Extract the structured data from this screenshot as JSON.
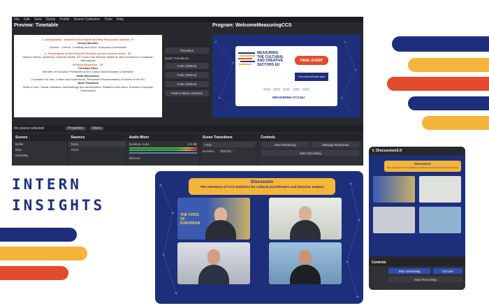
{
  "colors": {
    "navy": "#1d2f7a",
    "orange": "#f5b43a",
    "red": "#e24b2c",
    "obs_bg": "#27292f"
  },
  "heading": {
    "line1": "INTERN",
    "line2": "INSIGHTS"
  },
  "obs": {
    "menu": [
      "File",
      "Edit",
      "View",
      "Docks",
      "Profile",
      "Scene Collection",
      "Tools",
      "Help"
    ],
    "preview_title": "Preview: Timetable",
    "program_title": "Program: WelcomeMeasuringCCS",
    "timetable": {
      "item1": "1. Introduction - context of the report and why this project started - 5'",
      "speaker1": "Georg Haeusler",
      "role1": "Director - Culture, Creativity and Sport, European Commission",
      "item2": "2. Presentation of the Project's Results by the research team - 30'",
      "team": "Manuel Villoria, Q/metrica, Giacomo Bufali, NTT Data, Pau Rausell, Rafael B. Boix Domenech, Fundación Alternativas",
      "item3": "3.Policy Response - 20'",
      "speaker2": "Christian Ehler",
      "role2": "Member of European Parliament of the Culture and Education Committee",
      "speaker3": "Heidi Meissnitzer",
      "role3": "Counsellor for Arts, Culture and Audiovisual, Permanent Representation of Austria to the EU",
      "speaker4": "Jarko Paananen",
      "role4": "Head of Unit - Social Indicators; Methodology and development; Relations with users, Eurostat, European Commission"
    },
    "transitions": {
      "transition_btn": "Transition",
      "quick_label": "Quick Transitions",
      "fade1": "Fade (300ms)",
      "fade2": "Fade (300ms)",
      "fade3": "Fade (300ms)",
      "fade_black": "Fade to Black (300ms)"
    },
    "program_card": {
      "logo_line1": "MEASURING",
      "logo_line2": "THE CULTURAL",
      "logo_line3": "AND CREATIVE",
      "logo_line4": "SECTORS EU",
      "final_event": "FINAL EVENT",
      "soon": "The event will start soon",
      "url": "MEASURING-CCS.EU"
    },
    "status": {
      "no_source": "No source selected",
      "properties": "Properties",
      "filters": "Filters"
    },
    "docks": {
      "scenes": {
        "title": "Scenes",
        "items": [
          "Buffer",
          "Blue",
          "Defaultfg"
        ]
      },
      "sources": {
        "title": "Sources",
        "items": [
          "Text1",
          "Text2"
        ]
      },
      "mixer": {
        "title": "Audio Mixer",
        "track": "Desktop Audio",
        "db": "0.0 dB",
        "mic": "Mic/Aux"
      },
      "transitions": {
        "title": "Scene Transitions",
        "type": "Fade",
        "duration_label": "Duration",
        "duration": "300 ms"
      },
      "controls": {
        "title": "Controls",
        "start_streaming": "Start Streaming",
        "manage_broadcast": "Manage Broadcast",
        "start_recording": "Start Recording"
      }
    }
  },
  "discussion": {
    "title": "Discussion",
    "subtitle": "The relevance of CCS statistics for cultural practitioners and decision makers",
    "tile_banner": "THE VOICE OF EUROPEAN"
  },
  "phone": {
    "title": "t: Discussion2.0",
    "banner_title": "Discussion",
    "banner_sub": "The relevance of CCS statistics for cultural practitioners and decision makers",
    "controls": "Controls",
    "stop_streaming": "Stop Streaming",
    "go_live": "Go Live",
    "start_recording": "Start Recording"
  }
}
